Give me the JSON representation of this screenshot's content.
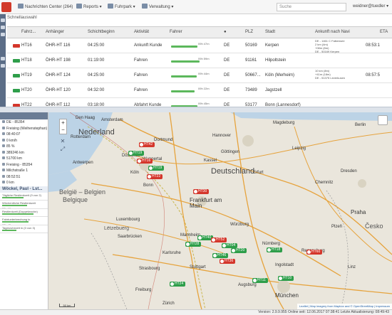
{
  "header": {
    "nachrichten": "Nachrichten Center (264)",
    "reports": "Reports",
    "fuhrpark": "Fuhrpark",
    "verwaltung": "Verwaltung",
    "search_placeholder": "Suche",
    "user": "weidner@tuedler"
  },
  "section_label": "Schnellauswahl",
  "table": {
    "columns": [
      "Fahrz...",
      "Anhänger",
      "Schichtbeginn",
      "Aktivität",
      "Fahrer",
      "",
      "PLZ",
      "Stadt",
      "Ankunft nach Navi",
      "ETA"
    ],
    "rows": [
      {
        "status_color": "#d4362b",
        "vehicle": "HT16",
        "trailer": "ÖHR-HT 116",
        "shift": "04:25:00",
        "activity": "Ankunft Kunde",
        "drive_time": "09h 47m",
        "drive_frac": 0.62,
        "country": "DE",
        "plz": "50169",
        "city": "Kerpen",
        "navi": [
          "DE - 1461 C Falkensee",
          "2 km (4m)",
          "+08m (8m)",
          "DE - 50169 Kerpen"
        ],
        "eta": "08:53:1"
      },
      {
        "status_color": "#2e9e4a",
        "vehicle": "HT18",
        "trailer": "ÖHR-HT 198",
        "shift": "01:19:00",
        "activity": "Fahren",
        "drive_time": "09h 59m",
        "drive_frac": 0.66,
        "country": "DE",
        "plz": "91161",
        "city": "Hilpoltstein",
        "navi": [],
        "eta": ""
      },
      {
        "status_color": "#2e9e4a",
        "vehicle": "HT19",
        "trailer": "ÖHR-HT 124",
        "shift": "04:25:00",
        "activity": "Fahren",
        "drive_time": "09h 44m",
        "drive_frac": 0.6,
        "country": "DE",
        "plz": "50667...",
        "city": "Köln (Merheim)",
        "navi": [
          "10 km (8m)",
          "+41m (18m)",
          "DE - 51375 Leverkusen"
        ],
        "eta": "08:57:5"
      },
      {
        "status_color": "#2e9e4a",
        "vehicle": "HT20",
        "trailer": "ÖHR-HT 120",
        "shift": "04:32:00",
        "activity": "Fahren",
        "drive_time": "09h 22m",
        "drive_frac": 0.55,
        "country": "DE",
        "plz": "73489",
        "city": "Jagstzell",
        "navi": [],
        "eta": ""
      },
      {
        "status_color": "#d4362b",
        "vehicle": "HT22",
        "trailer": "ÖHR-HT 112",
        "shift": "03:18:00",
        "activity": "Abfahrt Kunde",
        "drive_time": "09h 45m",
        "drive_frac": 0.62,
        "country": "DE",
        "plz": "53177",
        "city": "Bonn (Lannesdorf)",
        "navi": [],
        "eta": ""
      }
    ]
  },
  "sidebar": {
    "items": [
      "DE - 85354",
      "Freising (Weihenstephan)",
      "08:40:07",
      "0 km/h",
      "85 %",
      "389246 km",
      "51700 km",
      "Freising - 85354",
      "Milchstraße 1",
      "08:52:51",
      "0 km"
    ],
    "driver": "Wöckel, Paul - Lst...",
    "blocks": [
      {
        "title": "Tägliche Restlenkzeit (9 von 2)",
        "line1": "02h 15m",
        "line2": "max 4h 30m",
        "frac": 0.5
      },
      {
        "title": "Wöchentliche Restlenkzeit",
        "line1": "32h 15m",
        "line2": "max 56h 00m",
        "frac": 0.58
      },
      {
        "title": "Restlenkzeit (Doppelwoche)",
        "line1": "66h 15m",
        "line2": "max 90h 00m",
        "frac": 0.74
      },
      {
        "title": "Fahrtunterbrechung in",
        "line1": "02h 45m",
        "line2": "max 4h 30m",
        "frac": 0.61
      },
      {
        "title": "Tagesruhezeit in (0 von 3)",
        "line1": "04h 15m",
        "line2": "max 13h 00m",
        "frac": 0.33
      }
    ]
  },
  "map": {
    "countries": {
      "nl": "Nederland",
      "de": "Deutschland",
      "be": "België – Belgien",
      "be2": "Belgique",
      "cz": "Česko",
      "lu": "Lëtzebuerg"
    },
    "cities": [
      "Den Haag",
      "Amsterdam",
      "Hannover",
      "Magdeburg",
      "Rotterdam",
      "Dortmund",
      "Göttingen",
      "Leipzig",
      "Antwerpen",
      "Köln",
      "Erfurt",
      "Dresden",
      "Kassel",
      "Chemnitz",
      "Frankfurt am Main",
      "Praha",
      "Luxembourg",
      "Würzburg",
      "Plzeň",
      "Saarbrücken",
      "Nürnberg",
      "Stuttgart",
      "Regensburg",
      "Karlsruhe",
      "Ingolstadt",
      "Augsburg",
      "München",
      "Strasbourg",
      "Freiburg",
      "Zürich",
      "Berlin",
      "Düsseldorf",
      "Wuppertal",
      "Bonn",
      "Mannheim",
      "Linz"
    ],
    "markers": [
      {
        "label": "HT42",
        "color": "red"
      },
      {
        "label": "HT19",
        "color": "green"
      },
      {
        "label": "HT16",
        "color": "red"
      },
      {
        "label": "HT19",
        "color": "green"
      },
      {
        "label": "HT22",
        "color": "red"
      },
      {
        "label": "HT30",
        "color": "red"
      },
      {
        "label": "HT40",
        "color": "green"
      },
      {
        "label": "HT28",
        "color": "green"
      },
      {
        "label": "HT52",
        "color": "red"
      },
      {
        "label": "HT04",
        "color": "green"
      },
      {
        "label": "HT20",
        "color": "green"
      },
      {
        "label": "HT46",
        "color": "green"
      },
      {
        "label": "HT36",
        "color": "red"
      },
      {
        "label": "HT18",
        "color": "green"
      },
      {
        "label": "HT60",
        "color": "red"
      },
      {
        "label": "HT24",
        "color": "green"
      },
      {
        "label": "HT11",
        "color": "green"
      },
      {
        "label": "HT10",
        "color": "green"
      }
    ],
    "attribution": "Leaflet | Map imagery from Mapbox and © OpenStreetMap",
    "scale": "50 km",
    "impressum": "Impressum"
  },
  "status": {
    "text": "Version: 2.9.9.955   Online seit: 12.06.2017 07:38:41   Letzte Aktualisierung: 08:49:43"
  }
}
